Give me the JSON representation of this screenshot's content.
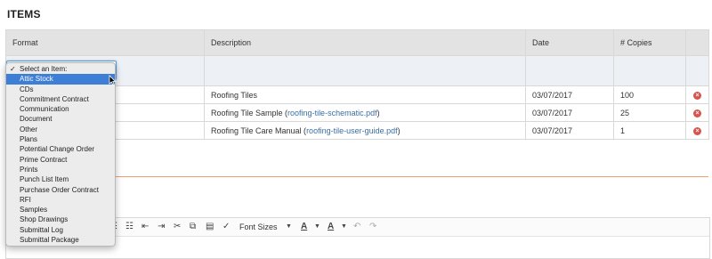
{
  "heading": "ITEMS",
  "table": {
    "columns": [
      "Format",
      "Description",
      "Date",
      "# Copies",
      ""
    ],
    "rows": [
      {
        "description": "Roofing Tiles",
        "date": "03/07/2017",
        "copies": "100"
      },
      {
        "description_pre": "Roofing Tile Sample (",
        "link": "roofing-tile-schematic.pdf",
        "description_post": ")",
        "date": "03/07/2017",
        "copies": "25"
      },
      {
        "description_pre": "Roofing Tile Care Manual (",
        "link": "roofing-tile-user-guide.pdf",
        "description_post": ")",
        "date": "03/07/2017",
        "copies": "1"
      }
    ]
  },
  "dropdown": {
    "options": [
      "Select an Item:",
      "Attic Stock",
      "CDs",
      "Commitment Contract",
      "Communication",
      "Document",
      "Other",
      "Plans",
      "Potential Change Order",
      "Prime Contract",
      "Prints",
      "Punch List Item",
      "Purchase Order Contract",
      "RFI",
      "Samples",
      "Shop Drawings",
      "Submittal Log",
      "Submittal Package"
    ],
    "checked_index": 0,
    "highlighted_index": 1
  },
  "toolbar": {
    "font_size_label": "Font Sizes",
    "text_color_label": "A",
    "bg_color_label": "A"
  },
  "icons": {
    "delete": "x-circle-icon",
    "checkmark": "✓"
  },
  "colors": {
    "highlight": "#3d7fd6",
    "link": "#3a6ea5",
    "delete": "#d9534f",
    "divider": "#f0a070",
    "header_bg": "#e3e3e3",
    "input_row_bg": "#edf1f5"
  }
}
